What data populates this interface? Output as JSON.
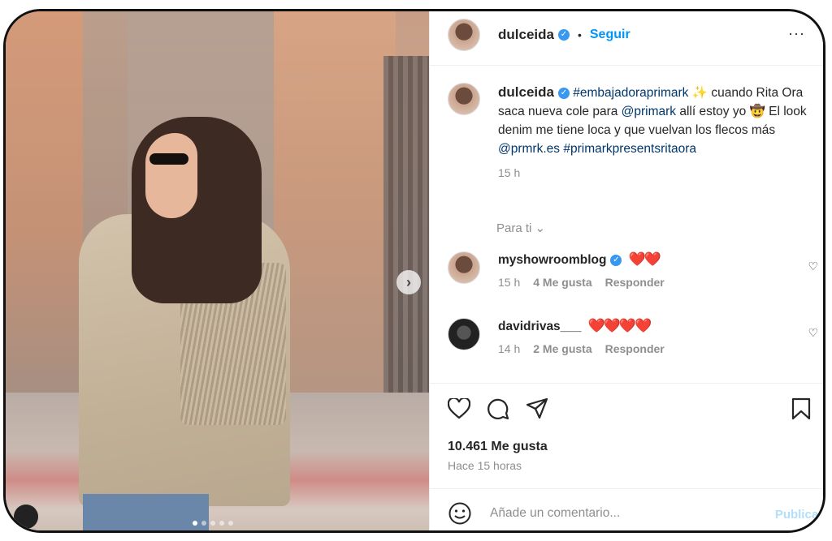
{
  "post": {
    "username": "dulceida",
    "follow_label": "Seguir",
    "more_icon": "more-options-icon",
    "caption": {
      "username": "dulceida",
      "hashtag1": "#embajadoraprimark",
      "sparkle": "✨",
      "text1": " cuando Rita Ora saca nueva cole para ",
      "mention1": "@primark",
      "text2": " allí estoy yo ",
      "cowboy": "🤠",
      "text3": " El look denim me tiene loca y que vuelvan los flecos más ",
      "mention2": "@prmrk.es",
      "hashtag2": "#primarkpresentsritaora",
      "time": "15 h"
    },
    "para_ti": "Para ti ⌄"
  },
  "comments": [
    {
      "username": "myshowroomblog",
      "verified": true,
      "text": "❤️❤️",
      "time": "15 h",
      "likes": "4 Me gusta",
      "reply": "Responder"
    },
    {
      "username": "davidrivas___",
      "verified": false,
      "text": "❤️❤️❤️❤️",
      "time": "14 h",
      "likes": "2 Me gusta",
      "reply": "Responder"
    }
  ],
  "stats": {
    "likes": "10.461 Me gusta",
    "ago": "Hace 15 horas"
  },
  "composer": {
    "placeholder": "Añade un comentario...",
    "publish_label": "Publicar"
  },
  "carousel": {
    "count": 5,
    "active": 1
  },
  "colors": {
    "accent": "#0095f6",
    "verified": "#3897f0",
    "link": "#00376b",
    "heart": "#e0293f"
  }
}
